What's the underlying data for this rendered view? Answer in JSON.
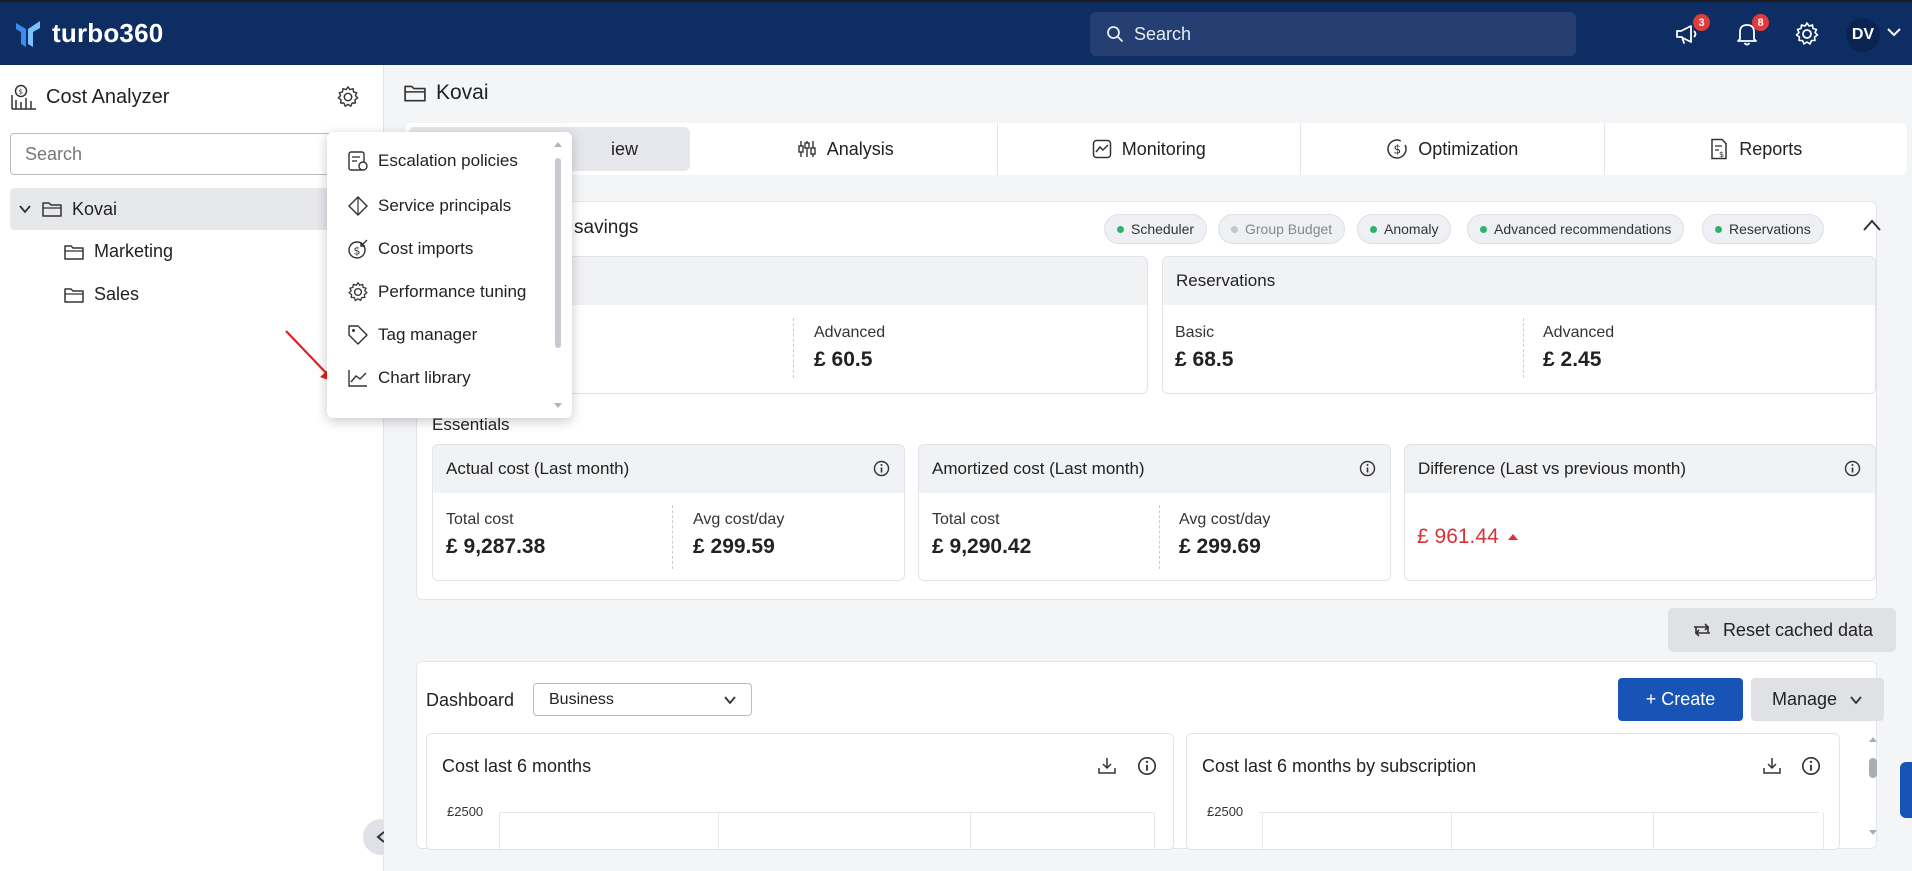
{
  "app": {
    "brand": "turbo360"
  },
  "topbar": {
    "search_placeholder": "Search",
    "announcements_count": "3",
    "notifications_count": "8",
    "user_initials": "DV"
  },
  "sidebar": {
    "title": "Cost Analyzer",
    "search_placeholder": "Search",
    "tree": [
      {
        "label": "Kovai"
      },
      {
        "label": "Marketing"
      },
      {
        "label": "Sales"
      }
    ]
  },
  "settings_menu": {
    "items": [
      {
        "label": "Escalation policies"
      },
      {
        "label": "Service principals"
      },
      {
        "label": "Cost imports"
      },
      {
        "label": "Performance tuning"
      },
      {
        "label": "Tag manager"
      },
      {
        "label": "Chart library"
      }
    ]
  },
  "main": {
    "title": "Kovai",
    "tabs": [
      {
        "label": "iew"
      },
      {
        "label": "Analysis"
      },
      {
        "label": "Monitoring"
      },
      {
        "label": "Optimization"
      },
      {
        "label": "Reports"
      }
    ],
    "savings": {
      "title": "ly savings",
      "chips": [
        {
          "label": "Scheduler"
        },
        {
          "label": "Group Budget"
        },
        {
          "label": "Anomaly"
        },
        {
          "label": "Advanced recommendations"
        },
        {
          "label": "Reservations"
        }
      ],
      "left_card": {
        "advanced_label": "Advanced",
        "advanced_value": "£ 60.5"
      },
      "reservations_card": {
        "title": "Reservations",
        "basic_label": "Basic",
        "basic_value": "£ 68.5",
        "advanced_label": "Advanced",
        "advanced_value": "£ 2.45"
      }
    },
    "essentials": {
      "title": "Essentials",
      "actual": {
        "title": "Actual cost (Last month)",
        "total_label": "Total cost",
        "total_value": "£ 9,287.38",
        "avg_label": "Avg cost/day",
        "avg_value": "£ 299.59"
      },
      "amortized": {
        "title": "Amortized cost (Last month)",
        "total_label": "Total cost",
        "total_value": "£ 9,290.42",
        "avg_label": "Avg cost/day",
        "avg_value": "£ 299.69"
      },
      "difference": {
        "title": "Difference (Last vs previous month)",
        "value": "£ 961.44"
      }
    },
    "reset_label": "Reset cached data",
    "dashboard": {
      "label": "Dashboard",
      "selected": "Business",
      "create_label": "+ Create",
      "manage_label": "Manage",
      "charts": [
        {
          "title": "Cost last 6 months",
          "tick": "£2500"
        },
        {
          "title": "Cost last 6 months by subscription",
          "tick": "£2500"
        }
      ]
    }
  },
  "colors": {
    "topbar": "#0d2d63",
    "primary": "#1754b5",
    "negative": "#d9313a",
    "active_dot": "#2fb36b"
  }
}
